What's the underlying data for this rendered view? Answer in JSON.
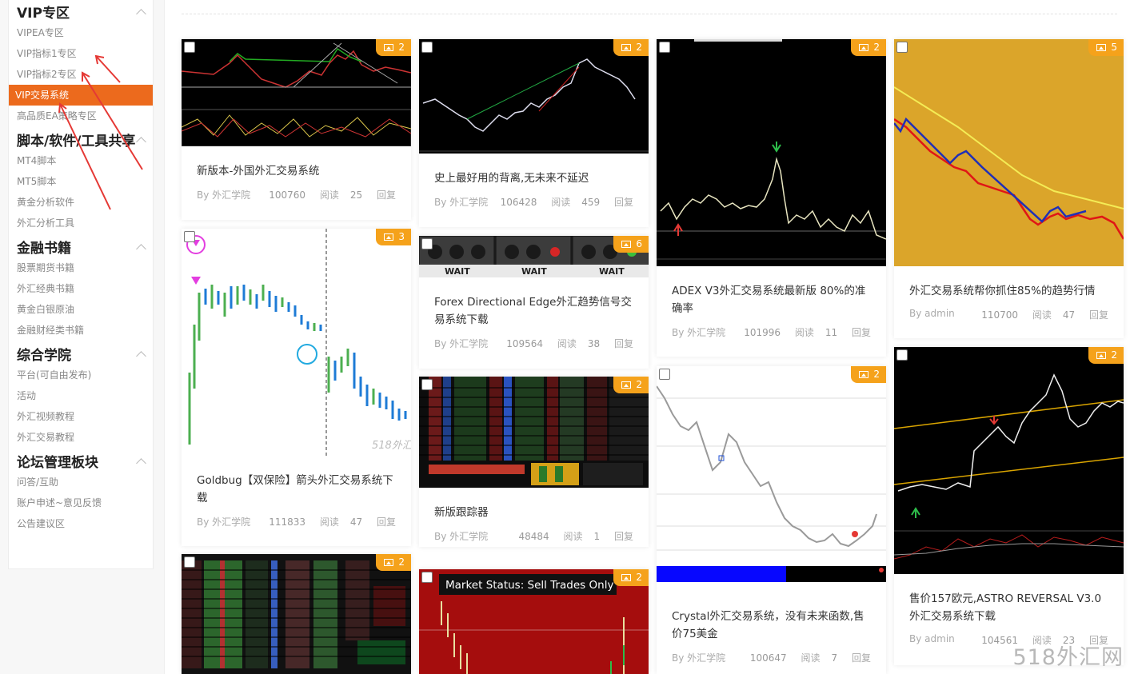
{
  "sidebar": {
    "groups": [
      {
        "title": "VIP专区",
        "items": [
          "VIPEA专区",
          "VIP指标1专区",
          "VIP指标2专区",
          "VIP交易系统",
          "高品质EA策略专区"
        ],
        "active": 3
      },
      {
        "title": "脚本/软件/工具共享",
        "items": [
          "MT4脚本",
          "MT5脚本",
          "黄金分析软件",
          "外汇分析工具"
        ]
      },
      {
        "title": "金融书籍",
        "items": [
          "股票期货书籍",
          "外汇经典书籍",
          "黄金白银原油",
          "金融财经类书籍"
        ]
      },
      {
        "title": "综合学院",
        "items": [
          "平台(可自由发布)",
          "活动",
          "外汇视频教程",
          "外汇交易教程"
        ]
      },
      {
        "title": "论坛管理板块",
        "items": [
          "问答/互助",
          "账户申述~意见反馈",
          "公告建议区"
        ]
      }
    ]
  },
  "labels": {
    "by": "By",
    "reads": "阅读",
    "replies": "回复"
  },
  "cards": [
    {
      "badge": "2",
      "title": "新版本-外国外汇交易系统",
      "author": "外汇学院",
      "reads": "100760",
      "replies": "25"
    },
    {
      "badge": "3",
      "title": "Goldbug【双保险】箭头外汇交易系统下载",
      "author": "外汇学院",
      "reads": "111833",
      "replies": "47"
    },
    {
      "badge": "2"
    },
    {
      "badge": "2",
      "title": "史上最好用的背离,无未来不延迟",
      "author": "外汇学院",
      "reads": "106428",
      "replies": "459"
    },
    {
      "badge": "6",
      "title": "Forex Directional Edge外汇趋势信号交易系统下载",
      "author": "外汇学院",
      "reads": "109564",
      "replies": "38",
      "overlay": [
        "WAIT",
        "WAIT",
        "WAIT"
      ]
    },
    {
      "badge": "2",
      "title": "新版跟踪器",
      "author": "外汇学院",
      "reads": "48484",
      "replies": "1"
    },
    {
      "badge": "2",
      "overlay_text": "Market Status: Sell Trades Only"
    },
    {
      "badge": "2",
      "title": "ADEX V3外汇交易系统最新版 80%的准确率",
      "author": "外汇学院",
      "reads": "101996",
      "replies": "11"
    },
    {
      "badge": "2",
      "title": "Crystal外汇交易系统，没有未来函数,售价75美金",
      "author": "外汇学院",
      "reads": "100647",
      "replies": "7"
    },
    {
      "badge": "5",
      "title": "外汇交易系统帮你抓住85%的趋势行情",
      "author": "admin",
      "reads": "110700",
      "replies": "47"
    },
    {
      "badge": "2",
      "title": "售价157欧元,ASTRO REVERSAL V3.0外汇交易系统下载",
      "author": "admin",
      "reads": "104561",
      "replies": "23"
    }
  ],
  "watermark": "518外汇网",
  "goldbug_watermark": "518外汇",
  "colors": {
    "accent": "#ec6a1d",
    "badge": "#f5a21b",
    "arrow": "#e53935"
  }
}
